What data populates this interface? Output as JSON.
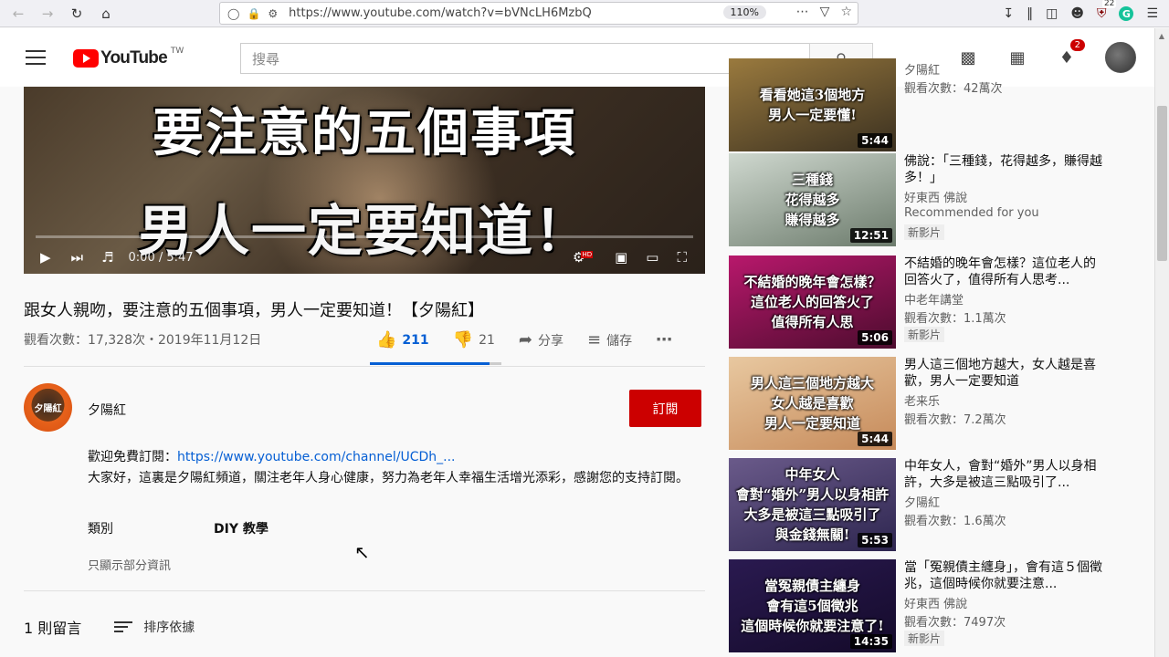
{
  "browser": {
    "url": "https://www.youtube.com/watch?v=bVNcLH6MzbQ",
    "zoom": "110%",
    "ext_count": "22"
  },
  "header": {
    "logo_text": "YouTube",
    "logo_region": "TW",
    "search_placeholder": "搜尋",
    "notification_count": "2"
  },
  "player": {
    "caption_line1": "要注意的五個事項",
    "caption_line2": "男人一定要知道！",
    "time": "0:00 / 5:47",
    "progress": 0
  },
  "video": {
    "title": "跟女人親吻，要注意的五個事項，男人一定要知道！【夕陽紅】",
    "views_date": "觀看次數：17,328次・2019年11月12日",
    "likes": "211",
    "dislikes": "21",
    "share_label": "分享",
    "save_label": "儲存",
    "like_ratio": 0.91
  },
  "channel": {
    "name": "夕陽紅",
    "avatar_text": "夕陽紅",
    "subscribe_label": "訂閱"
  },
  "description": {
    "line1_prefix": "歡迎免費訂閱：",
    "line1_link": "https://www.youtube.com/channel/UCDh_...",
    "line2": "大家好，這裏是夕陽紅頻道，關注老年人身心健康，努力為老年人幸福生活增光添彩，感謝您的支持訂閱。",
    "category_key": "類別",
    "category_value": "DIY 教學",
    "show_less": "只顯示部分資訊"
  },
  "comments": {
    "count_label": "1 則留言",
    "sort_label": "排序依據"
  },
  "recommendations": [
    {
      "thumb_text": "看看她這3個地方|男人一定要懂!",
      "duration": "5:44",
      "title": "",
      "channel": "夕陽紅",
      "views": "觀看次數：42萬次",
      "badge": ""
    },
    {
      "thumb_text": "三種錢|花得越多|賺得越多",
      "duration": "12:51",
      "title": "佛說：「三種錢，花得越多，賺得越多！」",
      "channel": "好東西 佛說",
      "views": "Recommended for you",
      "badge": "新影片"
    },
    {
      "thumb_text": "不結婚的晚年會怎樣？|這位老人的回答火了|值得所有人思",
      "duration": "5:06",
      "title": "不結婚的晚年會怎樣？這位老人的回答火了，值得所有人思考...",
      "channel": "中老年講堂",
      "views": "觀看次數：1.1萬次",
      "badge": "新影片"
    },
    {
      "thumb_text": "男人這三個地方越大|女人越是喜歡|男人一定要知道",
      "duration": "5:44",
      "title": "男人這三個地方越大，女人越是喜歡，男人一定要知道",
      "channel": "老来乐",
      "views": "觀看次數：7.2萬次",
      "badge": ""
    },
    {
      "thumb_text": "中年女人|會對“婚外”男人以身相許|大多是被這三點吸引了|與金錢無關!",
      "duration": "5:53",
      "title": "中年女人，會對“婚外”男人以身相許，大多是被這三點吸引了...",
      "channel": "夕陽紅",
      "views": "觀看次數：1.6萬次",
      "badge": ""
    },
    {
      "thumb_text": "當冤親債主纏身|會有這5個徵兆|這個時候你就要注意了!",
      "duration": "14:35",
      "title": "當「冤親債主纏身」，會有這５個徵兆，這個時候你就要注意...",
      "channel": "好東西 佛說",
      "views": "觀看次數：7497次",
      "badge": "新影片"
    }
  ],
  "colors": {
    "brand_red": "#ff0000",
    "subscribe_red": "#cc0000",
    "link_blue": "#065fd4"
  }
}
